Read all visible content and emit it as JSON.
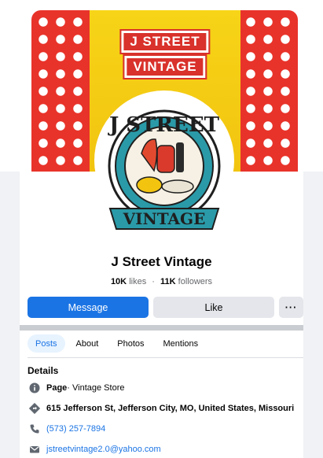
{
  "page": {
    "name": "J Street Vintage",
    "likes_count": "10K",
    "likes_label": "likes",
    "separator": "·",
    "followers_count": "11K",
    "followers_label": "followers"
  },
  "cover": {
    "sign_line1": "J STREET",
    "sign_line2": "VINTAGE",
    "logo_top": "J STREET",
    "logo_bottom": "VINTAGE"
  },
  "actions": {
    "message_label": "Message",
    "like_label": "Like",
    "more_label": "···"
  },
  "tabs": [
    {
      "label": "Posts",
      "active": true
    },
    {
      "label": "About",
      "active": false
    },
    {
      "label": "Photos",
      "active": false
    },
    {
      "label": "Mentions",
      "active": false
    }
  ],
  "details": {
    "title": "Details",
    "category_prefix": "Page",
    "category_text": " · Vintage Store",
    "address": "615 Jefferson St, Jefferson City, MO, United States, Missouri",
    "phone": "(573) 257-7894",
    "email": "jstreetvintage2.0@yahoo.com"
  },
  "colors": {
    "accent": "#1b74e4",
    "cover_red": "#e8332a",
    "cover_yellow": "#f7d417",
    "logo_teal": "#2a9aa8"
  },
  "icons": [
    "info-icon",
    "directions-icon",
    "phone-icon",
    "mail-icon",
    "more-icon"
  ]
}
